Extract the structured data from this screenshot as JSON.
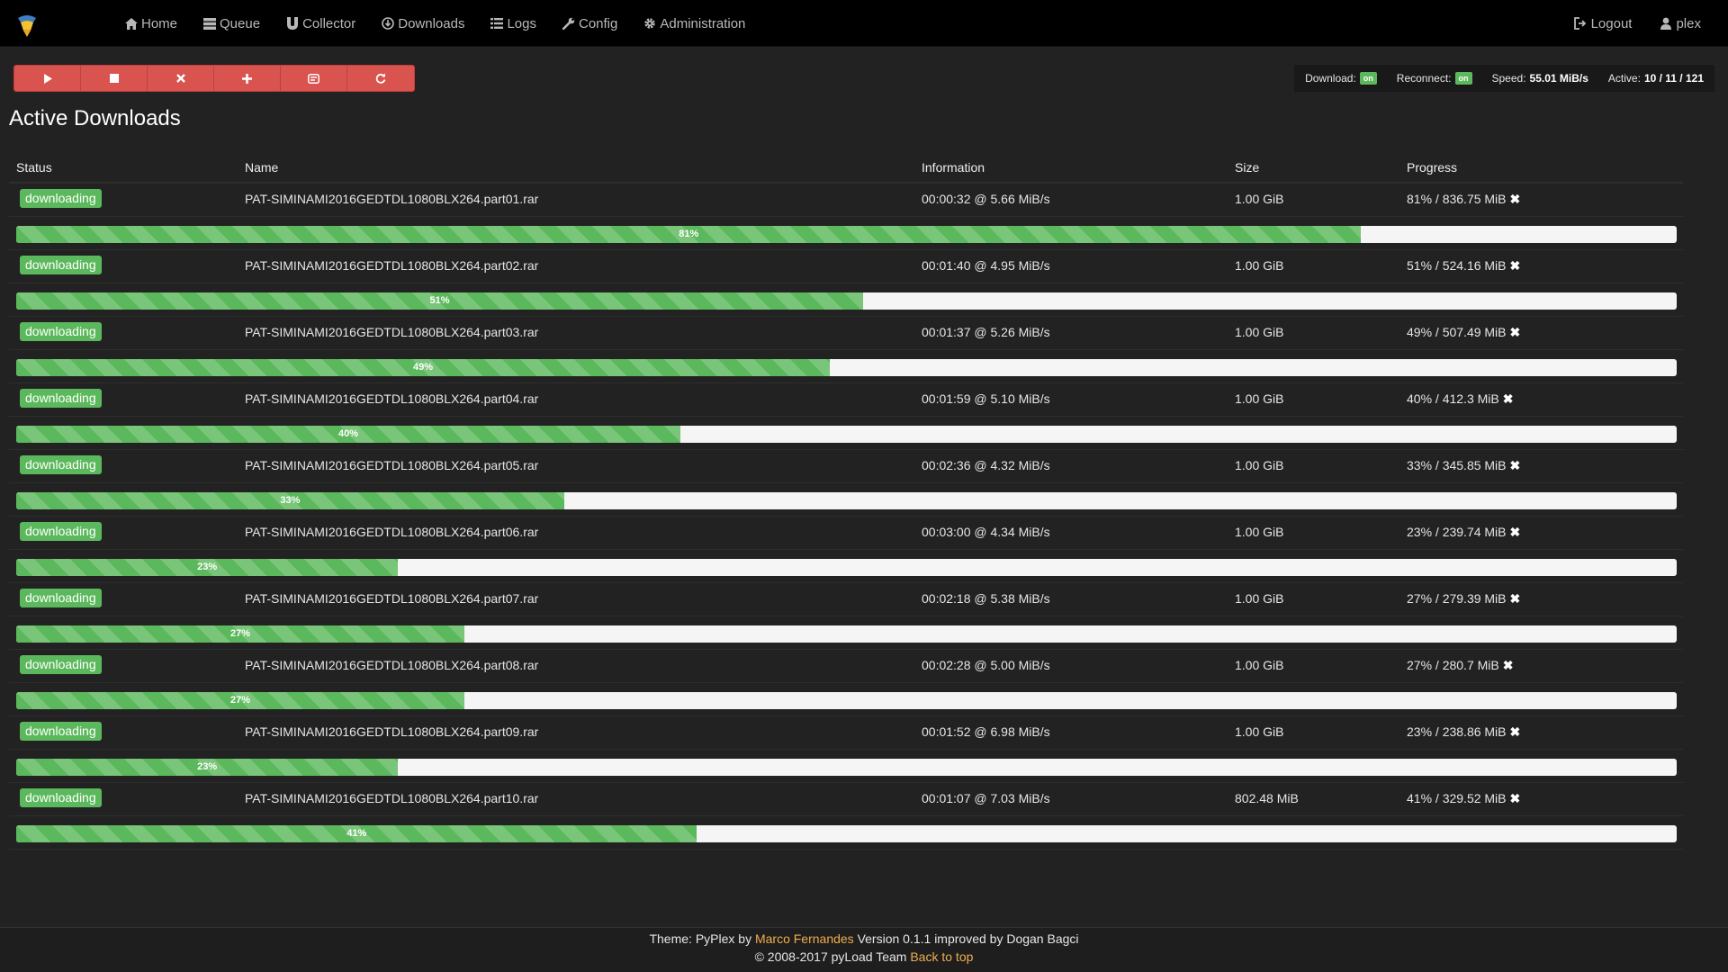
{
  "nav": {
    "items": [
      {
        "label": "Home",
        "icon": "home-icon"
      },
      {
        "label": "Queue",
        "icon": "queue-icon"
      },
      {
        "label": "Collector",
        "icon": "magnet-icon"
      },
      {
        "label": "Downloads",
        "icon": "download-icon"
      },
      {
        "label": "Logs",
        "icon": "list-icon"
      },
      {
        "label": "Config",
        "icon": "wrench-icon"
      },
      {
        "label": "Administration",
        "icon": "gear-icon"
      }
    ],
    "logout": "Logout",
    "user": "plex"
  },
  "toolbar": {
    "buttons": [
      "play-icon",
      "stop-icon",
      "cancel-icon",
      "add-icon",
      "captcha-icon",
      "restart-icon"
    ]
  },
  "status": {
    "download_label": "Download:",
    "download_value": "on",
    "reconnect_label": "Reconnect:",
    "reconnect_value": "on",
    "speed_label": "Speed:",
    "speed_value": "55.01 MiB/s",
    "active_label": "Active:",
    "active_value": "10 / 11 / 121"
  },
  "page_title": "Active Downloads",
  "table": {
    "headers": {
      "status": "Status",
      "name": "Name",
      "info": "Information",
      "size": "Size",
      "progress": "Progress"
    },
    "rows": [
      {
        "status": "downloading",
        "name": "PAT-SIMINAMI2016GEDTDL1080BLX264.part01.rar",
        "info": "00:00:32 @ 5.66 MiB/s",
        "size": "1.00 GiB",
        "progress_text": "81% / 836.75 MiB",
        "percent": 81,
        "bar_label": "81%"
      },
      {
        "status": "downloading",
        "name": "PAT-SIMINAMI2016GEDTDL1080BLX264.part02.rar",
        "info": "00:01:40 @ 4.95 MiB/s",
        "size": "1.00 GiB",
        "progress_text": "51% / 524.16 MiB",
        "percent": 51,
        "bar_label": "51%"
      },
      {
        "status": "downloading",
        "name": "PAT-SIMINAMI2016GEDTDL1080BLX264.part03.rar",
        "info": "00:01:37 @ 5.26 MiB/s",
        "size": "1.00 GiB",
        "progress_text": "49% / 507.49 MiB",
        "percent": 49,
        "bar_label": "49%"
      },
      {
        "status": "downloading",
        "name": "PAT-SIMINAMI2016GEDTDL1080BLX264.part04.rar",
        "info": "00:01:59 @ 5.10 MiB/s",
        "size": "1.00 GiB",
        "progress_text": "40% / 412.3 MiB",
        "percent": 40,
        "bar_label": "40%"
      },
      {
        "status": "downloading",
        "name": "PAT-SIMINAMI2016GEDTDL1080BLX264.part05.rar",
        "info": "00:02:36 @ 4.32 MiB/s",
        "size": "1.00 GiB",
        "progress_text": "33% / 345.85 MiB",
        "percent": 33,
        "bar_label": "33%"
      },
      {
        "status": "downloading",
        "name": "PAT-SIMINAMI2016GEDTDL1080BLX264.part06.rar",
        "info": "00:03:00 @ 4.34 MiB/s",
        "size": "1.00 GiB",
        "progress_text": "23% / 239.74 MiB",
        "percent": 23,
        "bar_label": "23%"
      },
      {
        "status": "downloading",
        "name": "PAT-SIMINAMI2016GEDTDL1080BLX264.part07.rar",
        "info": "00:02:18 @ 5.38 MiB/s",
        "size": "1.00 GiB",
        "progress_text": "27% / 279.39 MiB",
        "percent": 27,
        "bar_label": "27%"
      },
      {
        "status": "downloading",
        "name": "PAT-SIMINAMI2016GEDTDL1080BLX264.part08.rar",
        "info": "00:02:28 @ 5.00 MiB/s",
        "size": "1.00 GiB",
        "progress_text": "27% / 280.7 MiB",
        "percent": 27,
        "bar_label": "27%"
      },
      {
        "status": "downloading",
        "name": "PAT-SIMINAMI2016GEDTDL1080BLX264.part09.rar",
        "info": "00:01:52 @ 6.98 MiB/s",
        "size": "1.00 GiB",
        "progress_text": "23% / 238.86 MiB",
        "percent": 23,
        "bar_label": "23%"
      },
      {
        "status": "downloading",
        "name": "PAT-SIMINAMI2016GEDTDL1080BLX264.part10.rar",
        "info": "00:01:07 @ 7.03 MiB/s",
        "size": "802.48 MiB",
        "progress_text": "41% / 329.52 MiB",
        "percent": 41,
        "bar_label": "41%"
      }
    ]
  },
  "footer": {
    "line1_prefix": "Theme: PyPlex by",
    "line1_author": "Marco Fernandes",
    "line1_suffix": "Version 0.1.1 improved by Dogan Bagci",
    "line2_prefix": "© 2008-2017 pyLoad Team",
    "line2_link": "Back to top"
  },
  "colors": {
    "accent_green": "#5cb85c",
    "toolbar_red": "#d9534f",
    "link_orange": "#f0ad4e",
    "background": "#222222"
  }
}
